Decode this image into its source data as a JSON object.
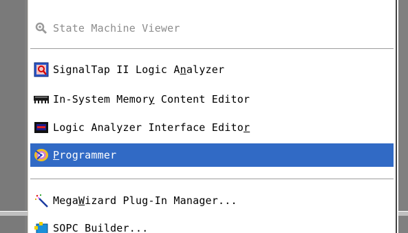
{
  "menu": {
    "items": [
      {
        "id": "state-machine-viewer",
        "prefix": "State Machine Viewer",
        "accel": "",
        "suffix": "",
        "disabled": true,
        "icon": "state-machine-icon"
      },
      {
        "id": "signaltap",
        "prefix": "SignalTap II Logic A",
        "accel": "n",
        "suffix": "alyzer",
        "disabled": false,
        "icon": "signaltap-icon"
      },
      {
        "id": "memory-editor",
        "prefix": "In-System Memor",
        "accel": "y",
        "suffix": " Content Editor",
        "disabled": false,
        "icon": "memory-chip-icon"
      },
      {
        "id": "lai-editor",
        "prefix": "Logic Analyzer Interface Edito",
        "accel": "r",
        "suffix": "",
        "disabled": false,
        "icon": "logic-analyzer-icon"
      },
      {
        "id": "programmer",
        "prefix": "",
        "accel": "P",
        "suffix": "rogrammer",
        "disabled": false,
        "selected": true,
        "icon": "programmer-icon"
      },
      {
        "id": "megawizard",
        "prefix": "Mega",
        "accel": "W",
        "suffix": "izard Plug-In Manager...",
        "disabled": false,
        "icon": "magic-wand-icon"
      },
      {
        "id": "sopc-builder",
        "prefix": "SOPC Builder...",
        "accel": "",
        "suffix": "",
        "disabled": false,
        "icon": "sopc-builder-icon"
      }
    ]
  },
  "colors": {
    "highlight": "#316ac5",
    "disabled_text": "#8c8c8c",
    "frame": "#808080"
  }
}
